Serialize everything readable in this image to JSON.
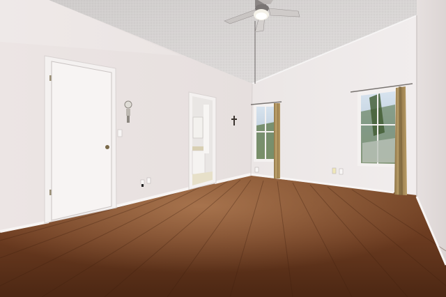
{
  "scene": {
    "kind": "photo",
    "room": "empty bedroom",
    "colors": {
      "ceiling": "#d8d4d3",
      "wall_left": "#ebe4e3",
      "wall_back": "#efeae9",
      "wall_right": "#e2dcdc",
      "floor_dark": "#5a2f18",
      "floor_light": "#8a5a3a",
      "door": "#f6f3f2",
      "trim": "#f4f1f0",
      "curtain": "#a98d5a",
      "window_glass": "#c9d8e6",
      "greenery": "#4f6b3c"
    },
    "objects": [
      "ceiling-fan-icon",
      "closed-door",
      "open-doorway-to-bathroom",
      "wall-sconce-icon",
      "window-left",
      "window-right",
      "curtain-panels",
      "hardwood-floor"
    ]
  }
}
